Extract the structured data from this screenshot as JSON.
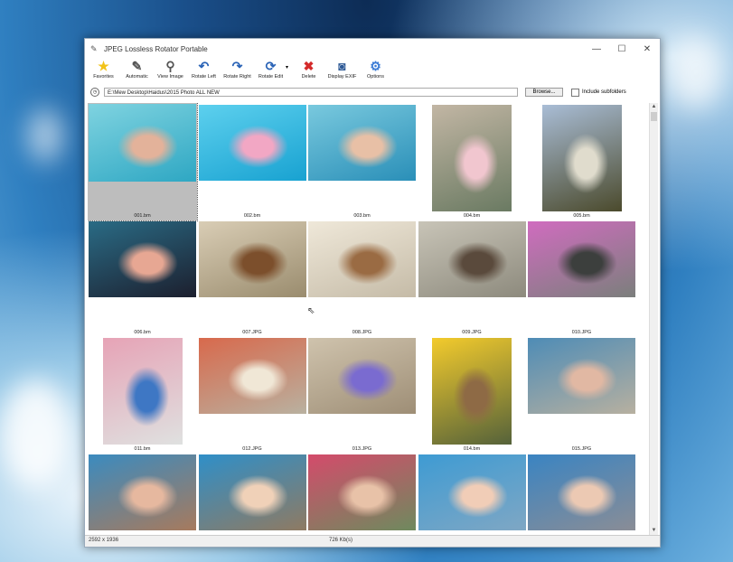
{
  "window": {
    "title": "JPEG Lossless Rotator Portable"
  },
  "toolbar": [
    {
      "label": "Favorites",
      "icon": "star-icon",
      "glyph": "★",
      "color": "#f2c318"
    },
    {
      "label": "Automatic",
      "icon": "magic-wand-icon",
      "glyph": "✎",
      "color": "#555555"
    },
    {
      "label": "View Image",
      "icon": "magnifier-icon",
      "glyph": "⚲",
      "color": "#555555"
    },
    {
      "label": "Rotate Left",
      "icon": "rotate-left-icon",
      "glyph": "↶",
      "color": "#2a63b6"
    },
    {
      "label": "Rotate Right",
      "icon": "rotate-right-icon",
      "glyph": "↷",
      "color": "#2a63b6"
    },
    {
      "label": "Rotate Edit",
      "icon": "rotate-edit-icon",
      "glyph": "⟳",
      "color": "#2a63b6"
    },
    {
      "label": "Delete",
      "icon": "delete-x-icon",
      "glyph": "✖",
      "color": "#d42a2a"
    },
    {
      "label": "Display EXIF",
      "icon": "camera-icon",
      "glyph": "◙",
      "color": "#2e5a96"
    },
    {
      "label": "Options",
      "icon": "options-icon",
      "glyph": "⚙",
      "color": "#3a7bd5"
    }
  ],
  "pathbar": {
    "path": "E:\\Mew Desktop\\Haidus\\2015 Photo ALL NEW",
    "browse_label": "Browse...",
    "include_subfolders_label": "Include subfolders"
  },
  "thumbnails": [
    {
      "name": "001.bm",
      "selected": true,
      "orient": "landscape",
      "colors": [
        "#2ea7c3",
        "#7fd3e0",
        "#e3b29a"
      ]
    },
    {
      "name": "002.bm",
      "orient": "landscape",
      "colors": [
        "#18a2d1",
        "#5dd0ee",
        "#f2a7c4"
      ]
    },
    {
      "name": "003.bm",
      "orient": "landscape",
      "colors": [
        "#2a8fb8",
        "#79c9de",
        "#e8c0a6"
      ]
    },
    {
      "name": "004.bm",
      "orient": "portrait",
      "colors": [
        "#6a7a62",
        "#c2b6a4",
        "#f1c6cf"
      ]
    },
    {
      "name": "005.bm",
      "orient": "portrait",
      "colors": [
        "#4b4a2c",
        "#a9bdd6",
        "#e0dccd"
      ]
    },
    {
      "name": "006.bm",
      "orient": "landscape",
      "colors": [
        "#1c1f2e",
        "#2a6b85",
        "#e7a793"
      ]
    },
    {
      "name": "007.JPG",
      "orient": "landscape",
      "colors": [
        "#9a8c6e",
        "#d9cdb5",
        "#7c4f2c"
      ]
    },
    {
      "name": "008.JPG",
      "orient": "landscape",
      "colors": [
        "#c5bba7",
        "#efe8d9",
        "#9a6b43"
      ]
    },
    {
      "name": "009.JPG",
      "orient": "landscape",
      "colors": [
        "#8d8a7d",
        "#c8c4b7",
        "#5a4a3c"
      ]
    },
    {
      "name": "010.JPG",
      "orient": "landscape",
      "colors": [
        "#7b7f7c",
        "#d06cbf",
        "#3c3f3d"
      ]
    },
    {
      "name": "011.bm",
      "orient": "portrait",
      "colors": [
        "#dfe1e0",
        "#e6a3b6",
        "#3e77c4"
      ]
    },
    {
      "name": "012.JPG",
      "orient": "landscape",
      "colors": [
        "#b9b1a0",
        "#d8694c",
        "#f0e7d6"
      ]
    },
    {
      "name": "013.JPG",
      "orient": "landscape",
      "colors": [
        "#9e8e76",
        "#cfc3ad",
        "#7a6bd0"
      ]
    },
    {
      "name": "014.bm",
      "orient": "portrait",
      "colors": [
        "#55623a",
        "#f3cb2c",
        "#8e6a45"
      ]
    },
    {
      "name": "015.JPG",
      "orient": "landscape",
      "colors": [
        "#b7b0a0",
        "#4e8cb6",
        "#e1b8a3"
      ]
    },
    {
      "name": "",
      "orient": "landscape",
      "colors": [
        "#a77a5d",
        "#3b8bbf",
        "#e6b89f"
      ]
    },
    {
      "name": "",
      "orient": "landscape",
      "colors": [
        "#8f7a62",
        "#2f8fc8",
        "#f0d1b8"
      ]
    },
    {
      "name": "",
      "orient": "landscape",
      "colors": [
        "#6e8a5e",
        "#d44b6b",
        "#e8c2a8"
      ]
    },
    {
      "name": "",
      "orient": "landscape",
      "colors": [
        "#7fa7c4",
        "#3e9bd3",
        "#f1cdb7"
      ]
    },
    {
      "name": "",
      "orient": "landscape",
      "colors": [
        "#8a8d96",
        "#3a84c2",
        "#ecc9b3"
      ]
    }
  ],
  "status": {
    "dimensions": "2592 x 1936",
    "size": "726 Kb(s)"
  }
}
